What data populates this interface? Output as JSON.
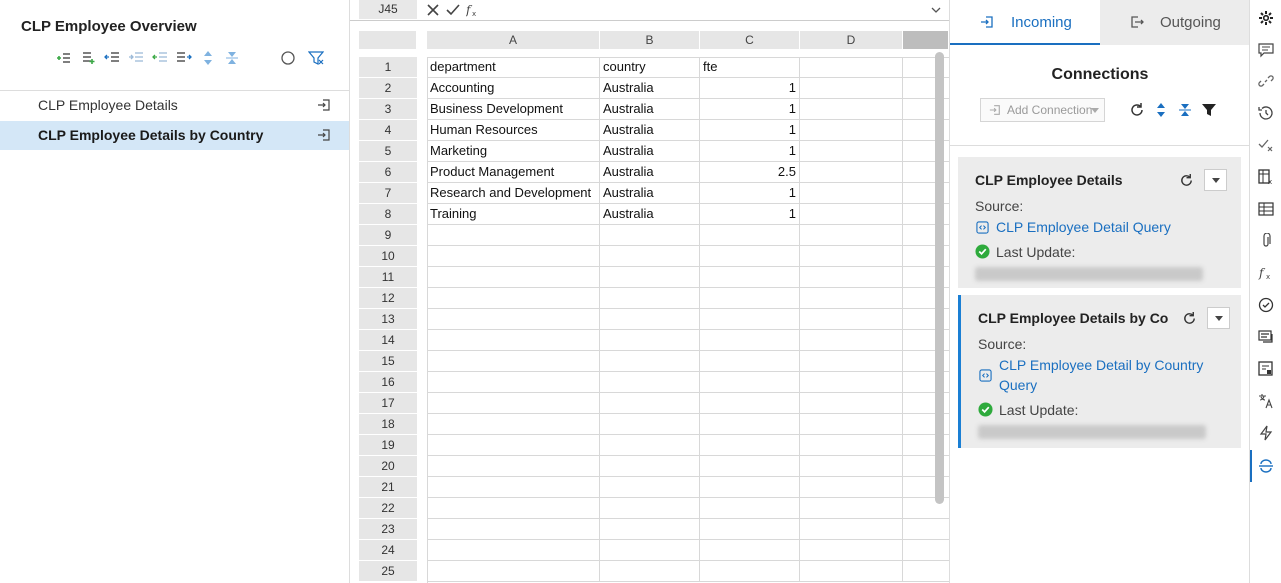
{
  "left": {
    "title": "CLP Employee Overview",
    "items": [
      {
        "label": "CLP Employee Details",
        "selected": false
      },
      {
        "label": "CLP Employee Details by Country",
        "selected": true
      }
    ]
  },
  "sheet": {
    "cell_ref": "J45",
    "columns": [
      "A",
      "B",
      "C",
      "D"
    ],
    "rows": [
      [
        "department",
        "country",
        "fte",
        ""
      ],
      [
        "Accounting",
        "Australia",
        "1",
        ""
      ],
      [
        "Business Development",
        "Australia",
        "1",
        ""
      ],
      [
        "Human Resources",
        "Australia",
        "1",
        ""
      ],
      [
        "Marketing",
        "Australia",
        "1",
        ""
      ],
      [
        "Product Management",
        "Australia",
        "2.5",
        ""
      ],
      [
        "Research and Development",
        "Australia",
        "1",
        ""
      ],
      [
        "Training",
        "Australia",
        "1",
        ""
      ]
    ],
    "row_numbers": [
      "1",
      "2",
      "3",
      "4",
      "5",
      "6",
      "7",
      "8",
      "9",
      "10",
      "11",
      "12",
      "13",
      "14",
      "15",
      "16",
      "17",
      "18",
      "19",
      "20",
      "21",
      "22",
      "23",
      "24",
      "25"
    ]
  },
  "right": {
    "tabs": {
      "incoming": "Incoming",
      "outgoing": "Outgoing"
    },
    "connections_title": "Connections",
    "add_connection": "Add Connection",
    "cards": [
      {
        "title": "CLP Employee Details",
        "source_label": "Source:",
        "source_link": "CLP Employee Detail Query",
        "update_label": "Last Update:"
      },
      {
        "title": "CLP Employee Details by Country",
        "source_label": "Source:",
        "source_link": "CLP Employee Detail by Country Query",
        "update_label": "Last Update:"
      }
    ]
  },
  "colors": {
    "accent": "#1a6fc0",
    "selected_row": "#d4e7f7",
    "success": "#2eaa3c"
  }
}
